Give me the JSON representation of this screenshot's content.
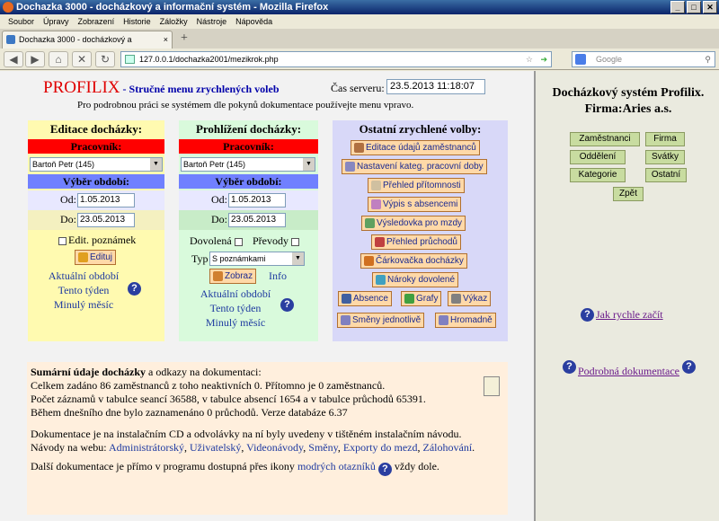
{
  "window": {
    "title": "Dochazka 3000 - docházkový a informační systém - Mozilla Firefox"
  },
  "menu": [
    "Soubor",
    "Úpravy",
    "Zobrazení",
    "Historie",
    "Záložky",
    "Nástroje",
    "Nápověda"
  ],
  "tab": {
    "label": "Dochazka 3000 - docházkový a informační s..."
  },
  "url": "127.0.0.1/dochazka2001/mezikrok.php",
  "search_placeholder": "Google",
  "header": {
    "brand": "PROFILIX",
    "dash": " - ",
    "subtitle": "Stručné menu zrychlených voleb",
    "server_label": "Čas serveru:",
    "server_time": "23.5.2013 11:18:07",
    "hint": "Pro podrobnou práci se systémem dle pokynů dokumentace používejte menu vpravo."
  },
  "edit": {
    "title": "Editace docházky:",
    "worker_label": "Pracovník:",
    "worker": "Bartoň Petr (145)",
    "period_label": "Výběr období:",
    "od_label": "Od:",
    "od": "1.05.2013",
    "do_label": "Do:",
    "do": "23.05.2013",
    "note_label": "Edit. poznámek",
    "button": "Edituj",
    "links": [
      "Aktuální období",
      "Tento týden",
      "Minulý měsíc"
    ]
  },
  "view": {
    "title": "Prohlížení docházky:",
    "worker_label": "Pracovník:",
    "worker": "Bartoň Petr (145)",
    "period_label": "Výběr období:",
    "od_label": "Od:",
    "od": "1.05.2013",
    "do_label": "Do:",
    "do": "23.05.2013",
    "vacation_label": "Dovolená",
    "transfers_label": "Převody",
    "type_label": "Typ",
    "type": "S poznámkami",
    "button": "Zobraz",
    "info": "Info",
    "links": [
      "Aktuální období",
      "Tento týden",
      "Minulý měsíc"
    ]
  },
  "other": {
    "title": "Ostatní zrychlené volby:",
    "buttons": [
      "Editace údajů zaměstnanců",
      "Nastavení kateg. pracovní doby",
      "Přehled přítomnosti",
      "Výpis s absencemi",
      "Výsledovka pro mzdy",
      "Přehled průchodů",
      "Čárkovačka docházky",
      "Nároky dovolené",
      "Absence",
      "Grafy",
      "Výkaz",
      "Směny jednotlivě",
      "Hromadně"
    ]
  },
  "summary": {
    "heading": "Sumární údaje docházky",
    "heading_rest": " a odkazy na dokumentaci:",
    "l1": "Celkem zadáno 86 zaměstnanců z toho neaktivních 0. Přítomno je 0 zaměstnanců.",
    "l2": "Počet záznamů v tabulce seancí 36588, v tabulce absencí 1654 a v tabulce průchodů 65391.",
    "l3": "Během dnešního dne bylo zaznamenáno 0 průchodů. Verze databáze 6.37",
    "l4": "Dokumentace je na instalačním CD a odvolávky na ní byly uvedeny v tištěném instalačním návodu.",
    "l5_pre": "Návody na webu:",
    "web_links": [
      "Administrátorský",
      "Uživatelský",
      "Videonávody",
      "Směny",
      "Exporty do mezd",
      "Zálohování"
    ],
    "l6_pre": "Další dokumentace je přímo v programu dostupná přes ikony",
    "l6_link": "modrých otazníků",
    "l6_post": "vždy dole."
  },
  "side": {
    "title1": "Docházkový systém Profilix.",
    "title2": "Firma:Aries a.s.",
    "buttons": [
      "Zaměstnanci",
      "Firma",
      "Oddělení",
      "Svátky",
      "Kategorie",
      "Ostatní",
      "Zpět"
    ],
    "quick": "Jak rychle začít",
    "docs": "Podrobná dokumentace"
  }
}
